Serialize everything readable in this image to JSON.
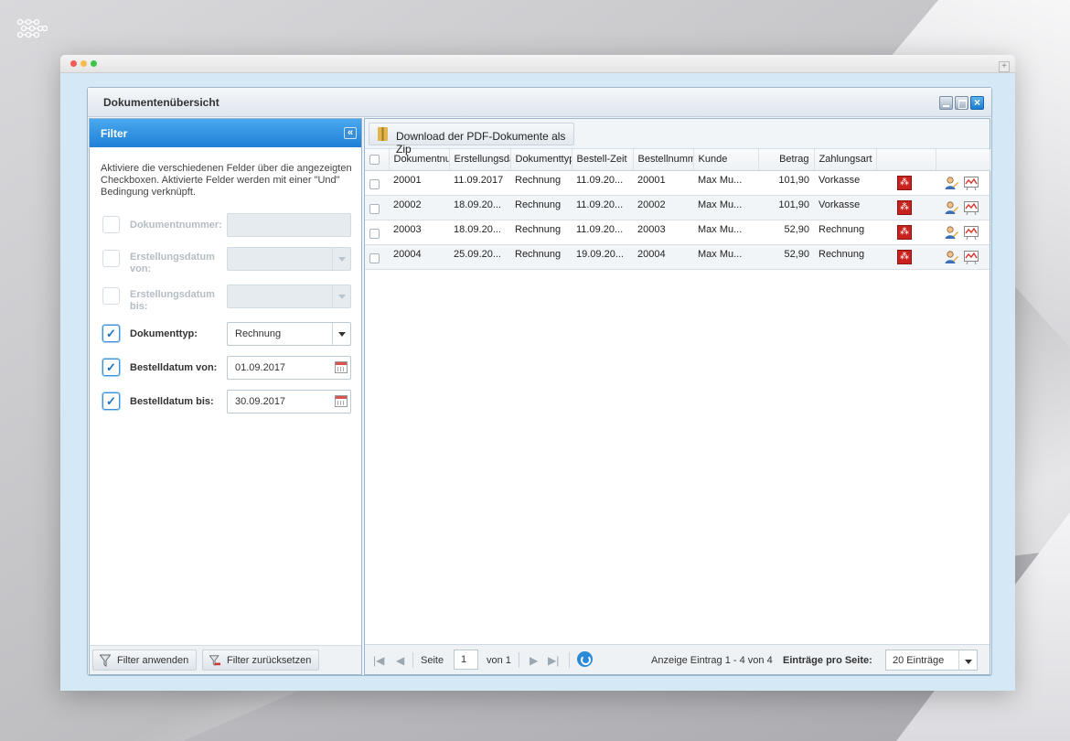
{
  "window": {
    "title": "Dokumentenübersicht"
  },
  "filter": {
    "title": "Filter",
    "collapse_glyph": "«",
    "description": "Aktiviere die verschiedenen Felder über die angezeigten Checkboxen. Aktivierte Felder werden mit einer \"Und\" Bedingung verknüpft.",
    "fields": [
      {
        "label": "Dokumentnummer:",
        "enabled": false,
        "value": "",
        "type": "text"
      },
      {
        "label": "Erstellungsdatum von:",
        "enabled": false,
        "value": "",
        "type": "combo"
      },
      {
        "label": "Erstellungsdatum bis:",
        "enabled": false,
        "value": "",
        "type": "combo"
      },
      {
        "label": "Dokumenttyp:",
        "enabled": true,
        "value": "Rechnung",
        "type": "combo"
      },
      {
        "label": "Bestelldatum von:",
        "enabled": true,
        "value": "01.09.2017",
        "type": "date"
      },
      {
        "label": "Bestelldatum bis:",
        "enabled": true,
        "value": "30.09.2017",
        "type": "date"
      }
    ],
    "apply_label": "Filter anwenden",
    "reset_label": "Filter zurücksetzen"
  },
  "grid": {
    "download_label": "Download der PDF-Dokumente als Zip",
    "columns": [
      "Dokumentnummer",
      "Erstellungsdatum",
      "Dokumenttyp",
      "Bestell-Zeit",
      "Bestellnummer",
      "Kunde",
      "Betrag",
      "Zahlungsart"
    ],
    "rows": [
      {
        "nr": "20001",
        "created": "11.09.2017",
        "type": "Rechnung",
        "order_time": "11.09.20...",
        "order_nr": "20001",
        "customer": "Max Mu...",
        "amount": "101,90",
        "payment": "Vorkasse"
      },
      {
        "nr": "20002",
        "created": "18.09.20...",
        "type": "Rechnung",
        "order_time": "11.09.20...",
        "order_nr": "20002",
        "customer": "Max Mu...",
        "amount": "101,90",
        "payment": "Vorkasse"
      },
      {
        "nr": "20003",
        "created": "18.09.20...",
        "type": "Rechnung",
        "order_time": "11.09.20...",
        "order_nr": "20003",
        "customer": "Max Mu...",
        "amount": "52,90",
        "payment": "Rechnung"
      },
      {
        "nr": "20004",
        "created": "25.09.20...",
        "type": "Rechnung",
        "order_time": "19.09.20...",
        "order_nr": "20004",
        "customer": "Max Mu...",
        "amount": "52,90",
        "payment": "Rechnung"
      }
    ]
  },
  "pager": {
    "page_label": "Seite",
    "page_value": "1",
    "of_label": "von 1",
    "display_info": "Anzeige Eintrag 1 - 4 von 4",
    "per_page_label": "Einträge pro Seite:",
    "per_page_value": "20 Einträge"
  },
  "colors": {
    "filter_header": "#2a8ad8",
    "window_bg": "#d5e8f5",
    "pdf_icon": "#c8221e"
  }
}
